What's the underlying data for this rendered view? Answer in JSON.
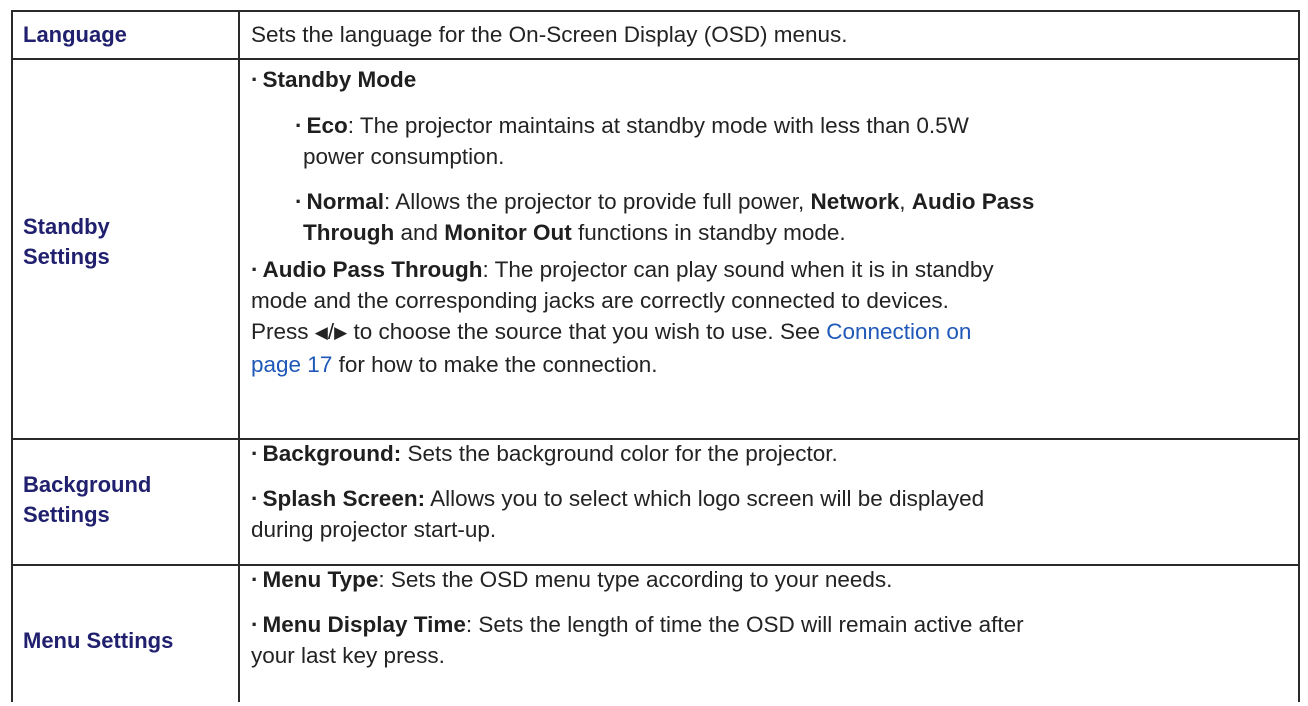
{
  "rows": [
    {
      "header": "Language",
      "text": "Sets the language for the On-Screen Display (OSD) menus."
    },
    {
      "header_line1": "Standby",
      "header_line2": "Settings",
      "standby_mode": "Standby Mode",
      "eco_label": "Eco",
      "eco_text_1": ": The projector maintains at standby mode with less than 0.5W",
      "eco_text_2": "power consumption.",
      "normal_label": "Normal",
      "normal_text_1": ": Allows the projector to provide full power, ",
      "network_label": "Network",
      "comma": ", ",
      "apt_label_1": "Audio Pass",
      "apt_label_2": "Through",
      "and": " and ",
      "monitor_out_label": "Monitor Out",
      "normal_text_2": " functions in standby mode.",
      "audio_pass_label": "Audio Pass Through",
      "audio_pass_text_1": ": The projector can play sound when it is in standby",
      "audio_pass_text_2": "mode and the corresponding jacks are correctly connected to devices.",
      "press": "Press ",
      "arrows_left": "◀",
      "arrows_slash": "/",
      "arrows_right": "▶",
      "press_text": " to choose the source that you wish to use. See ",
      "link_1": "Connection on",
      "link_2": "page 17",
      "after_link": " for how to make the connection."
    },
    {
      "header_line1": "Background",
      "header_line2": "Settings",
      "bg_label": "Background:",
      "bg_text": " Sets the background color for the projector.",
      "splash_label": "Splash Screen:",
      "splash_text_1": " Allows you to select which logo screen will be displayed",
      "splash_text_2": "during projector start-up."
    },
    {
      "header": "Menu Settings",
      "menu_type_label": "Menu Type",
      "menu_type_text": ": Sets the OSD menu type according to your needs.",
      "menu_time_label": "Menu Display Time",
      "menu_time_text_1": ": Sets the length of time the OSD will remain active after",
      "menu_time_text_2": "your last key press."
    }
  ],
  "bullet": "·"
}
